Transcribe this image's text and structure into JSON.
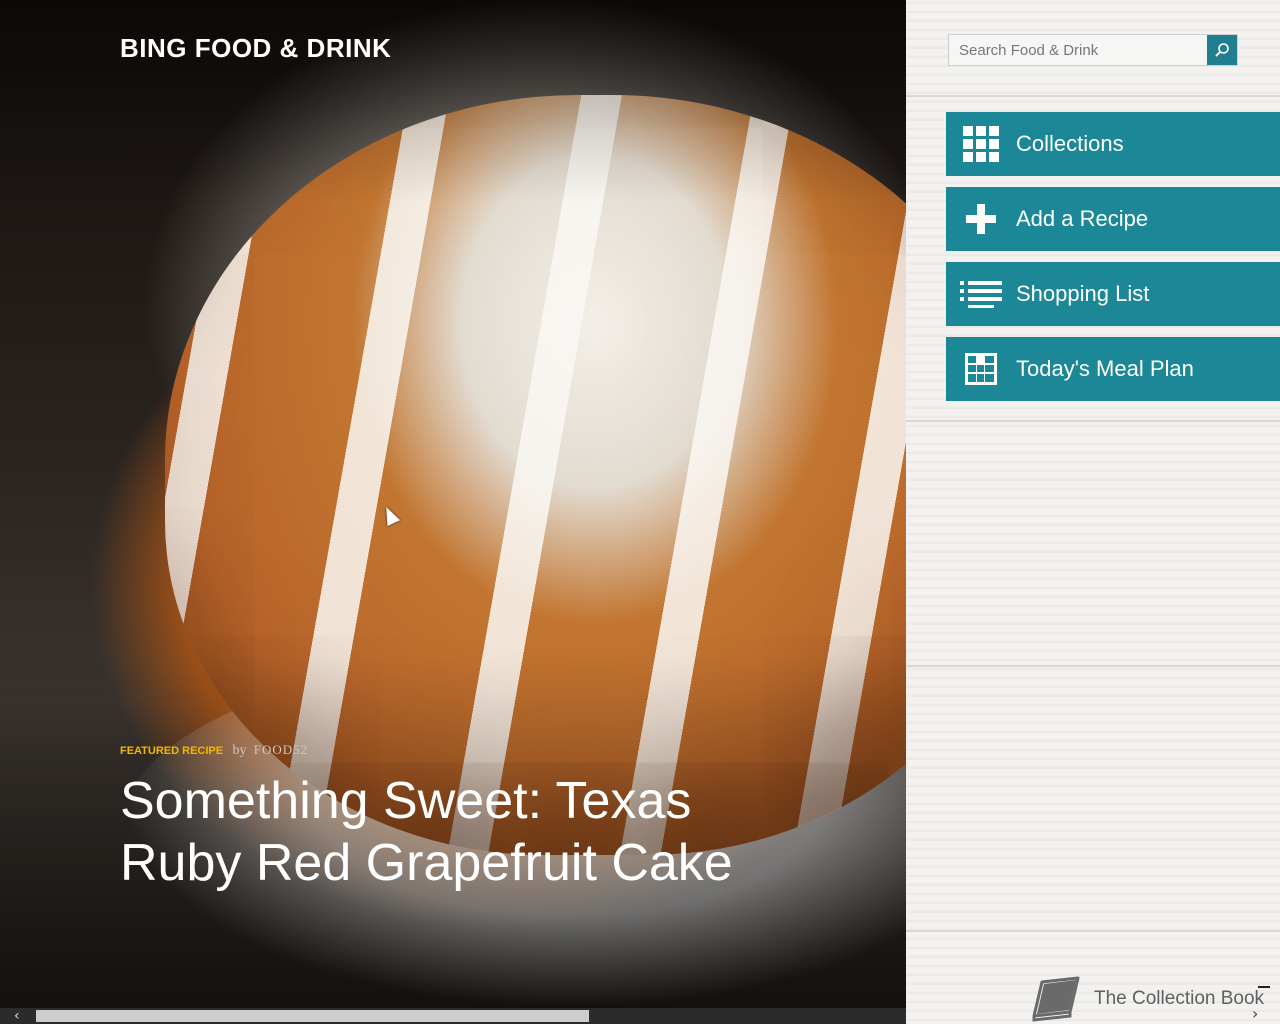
{
  "app": {
    "title": "BING FOOD & DRINK"
  },
  "featured": {
    "tag": "FEATURED RECIPE",
    "by": "by",
    "author": "FOOD52",
    "headline": "Something Sweet: Texas Ruby Red Grapefruit Cake"
  },
  "search": {
    "placeholder": "Search Food & Drink",
    "value": ""
  },
  "nav": [
    {
      "label": "Collections",
      "icon": "grid-icon"
    },
    {
      "label": "Add a Recipe",
      "icon": "plus-icon"
    },
    {
      "label": "Shopping List",
      "icon": "list-icon"
    },
    {
      "label": "Today's Meal Plan",
      "icon": "calendar-icon"
    }
  ],
  "collection_book": {
    "label": "The Collection Book",
    "icon": "book-icon"
  },
  "colors": {
    "accent": "#1c8796",
    "featured_tag": "#f2b800"
  },
  "scrollbar": {
    "position": 0.04,
    "visible_fraction": 0.61
  }
}
